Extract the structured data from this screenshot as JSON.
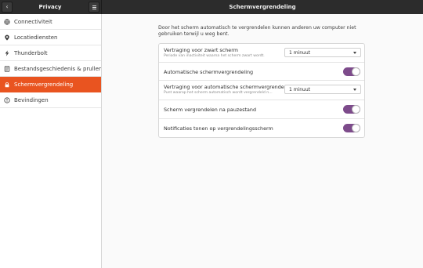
{
  "header": {
    "back_glyph": "‹",
    "left_title": "Privacy",
    "title": "Schermvergrendeling"
  },
  "sidebar": {
    "items": [
      {
        "label": "Connectiviteit",
        "icon": "connectivity-icon"
      },
      {
        "label": "Locatiediensten",
        "icon": "location-icon"
      },
      {
        "label": "Thunderbolt",
        "icon": "thunderbolt-icon"
      },
      {
        "label": "Bestandsgeschiedenis & prullenbak",
        "icon": "file-history-icon"
      },
      {
        "label": "Schermvergrendeling",
        "icon": "lock-icon",
        "active": true
      },
      {
        "label": "Bevindingen",
        "icon": "diagnostics-icon"
      }
    ]
  },
  "main": {
    "description": "Door het scherm automatisch te vergrendelen kunnen anderen uw computer niet gebruiken terwijl u weg bent.",
    "settings": [
      {
        "title": "Vertraging voor zwart scherm",
        "subtitle": "Periode van inactiviteit waarna het scherm zwart wordt.",
        "control": "dropdown",
        "value": "1 minuut"
      },
      {
        "title": "Automatische schermvergrendeling",
        "control": "toggle",
        "value": "on"
      },
      {
        "title": "Vertraging voor automatische schermvergrende…",
        "subtitle": "Punt waarop het scherm automatisch wordt vergrendeld n…",
        "control": "dropdown",
        "value": "1 minuut"
      },
      {
        "title": "Scherm vergrendelen na pauzestand",
        "control": "toggle",
        "value": "on"
      },
      {
        "title": "Notificaties tonen op vergrendelingsscherm",
        "control": "toggle",
        "value": "on"
      }
    ]
  },
  "colors": {
    "accent": "#e95420",
    "toggle_on": "#7d4b8b",
    "headerbar": "#2c2c2c"
  }
}
